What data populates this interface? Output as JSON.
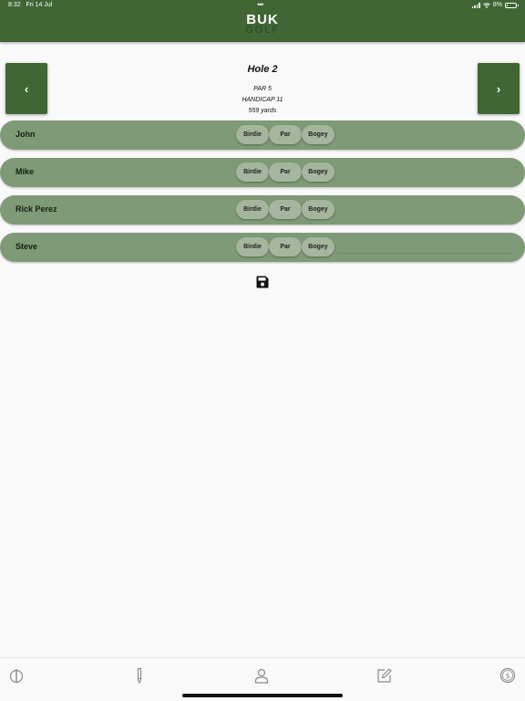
{
  "status_bar": {
    "time": "8:32",
    "date": "Fri 14 Jul",
    "dots": "•••",
    "battery": "8%"
  },
  "header": {
    "logo_top": "BUK",
    "logo_bottom": "GOLF"
  },
  "hole": {
    "prev_label": "‹",
    "next_label": "›",
    "title": "Hole 2",
    "par": "PAR 5",
    "handicap": "HANDICAP 11",
    "yards": "559 yards"
  },
  "score_options": [
    "Birdie",
    "Par",
    "Bogey"
  ],
  "players": [
    {
      "name": "John"
    },
    {
      "name": "Mike"
    },
    {
      "name": "Rick Perez"
    },
    {
      "name": "Steve"
    }
  ],
  "tabs": [
    {
      "icon": "golf-tee-icon"
    },
    {
      "icon": "pencil-icon"
    },
    {
      "icon": "person-icon"
    },
    {
      "icon": "edit-icon"
    },
    {
      "icon": "dollar-icon"
    }
  ],
  "colors": {
    "accent": "#3f6634",
    "row": "#7f9a76",
    "score_button": "#a5b69e",
    "background": "#f9f9f9"
  }
}
